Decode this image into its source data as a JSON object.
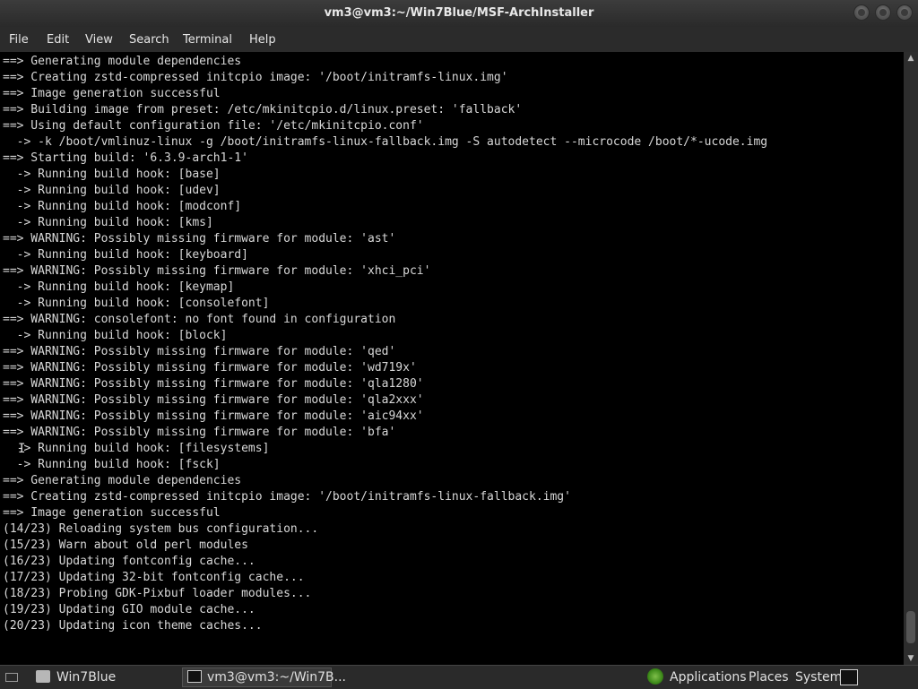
{
  "window": {
    "title": "vm3@vm3:~/Win7Blue/MSF-ArchInstaller"
  },
  "menubar": {
    "items": [
      "File",
      "Edit",
      "View",
      "Search",
      "Terminal",
      "Help"
    ]
  },
  "terminal": {
    "lines": [
      "==> Generating module dependencies",
      "==> Creating zstd-compressed initcpio image: '/boot/initramfs-linux.img'",
      "==> Image generation successful",
      "==> Building image from preset: /etc/mkinitcpio.d/linux.preset: 'fallback'",
      "==> Using default configuration file: '/etc/mkinitcpio.conf'",
      "  -> -k /boot/vmlinuz-linux -g /boot/initramfs-linux-fallback.img -S autodetect --microcode /boot/*-ucode.img",
      "==> Starting build: '6.3.9-arch1-1'",
      "  -> Running build hook: [base]",
      "  -> Running build hook: [udev]",
      "  -> Running build hook: [modconf]",
      "  -> Running build hook: [kms]",
      "==> WARNING: Possibly missing firmware for module: 'ast'",
      "  -> Running build hook: [keyboard]",
      "==> WARNING: Possibly missing firmware for module: 'xhci_pci'",
      "  -> Running build hook: [keymap]",
      "  -> Running build hook: [consolefont]",
      "==> WARNING: consolefont: no font found in configuration",
      "  -> Running build hook: [block]",
      "==> WARNING: Possibly missing firmware for module: 'qed'",
      "==> WARNING: Possibly missing firmware for module: 'wd719x'",
      "==> WARNING: Possibly missing firmware for module: 'qla1280'",
      "==> WARNING: Possibly missing firmware for module: 'qla2xxx'",
      "==> WARNING: Possibly missing firmware for module: 'aic94xx'",
      "==> WARNING: Possibly missing firmware for module: 'bfa'",
      "  -> Running build hook: [filesystems]",
      "  -> Running build hook: [fsck]",
      "==> Generating module dependencies",
      "==> Creating zstd-compressed initcpio image: '/boot/initramfs-linux-fallback.img'",
      "==> Image generation successful",
      "(14/23) Reloading system bus configuration...",
      "(15/23) Warn about old perl modules",
      "(16/23) Updating fontconfig cache...",
      "(17/23) Updating 32-bit fontconfig cache...",
      "(18/23) Probing GDK-Pixbuf loader modules...",
      "(19/23) Updating GIO module cache...",
      "(20/23) Updating icon theme caches..."
    ]
  },
  "taskbar": {
    "folder_task": "Win7Blue",
    "terminal_task": "vm3@vm3:~/Win7B...",
    "applications": "Applications",
    "places": "Places",
    "system": "System"
  }
}
